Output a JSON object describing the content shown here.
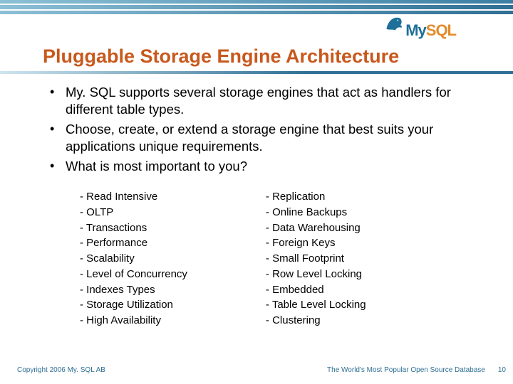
{
  "logo": {
    "text1": "My",
    "text2": "SQL"
  },
  "title": "Pluggable Storage Engine Architecture",
  "bullets": [
    "My. SQL supports several storage engines that act as handlers for different table types.",
    "Choose, create, or extend a storage engine that best suits your applications unique requirements.",
    "What is most important to you?"
  ],
  "col1": [
    "Read Intensive",
    "OLTP",
    "Transactions",
    "Performance",
    "Scalability",
    "Level of Concurrency",
    "Indexes Types",
    "Storage Utilization",
    "High Availability"
  ],
  "col2": [
    "Replication",
    "Online Backups",
    "Data Warehousing",
    "Foreign Keys",
    "Small Footprint",
    "Row Level Locking",
    "Embedded",
    "Table Level Locking",
    "Clustering"
  ],
  "footer": {
    "copyright": "Copyright 2006 My. SQL AB",
    "tagline": "The World's Most Popular Open Source Database",
    "page": "10"
  }
}
